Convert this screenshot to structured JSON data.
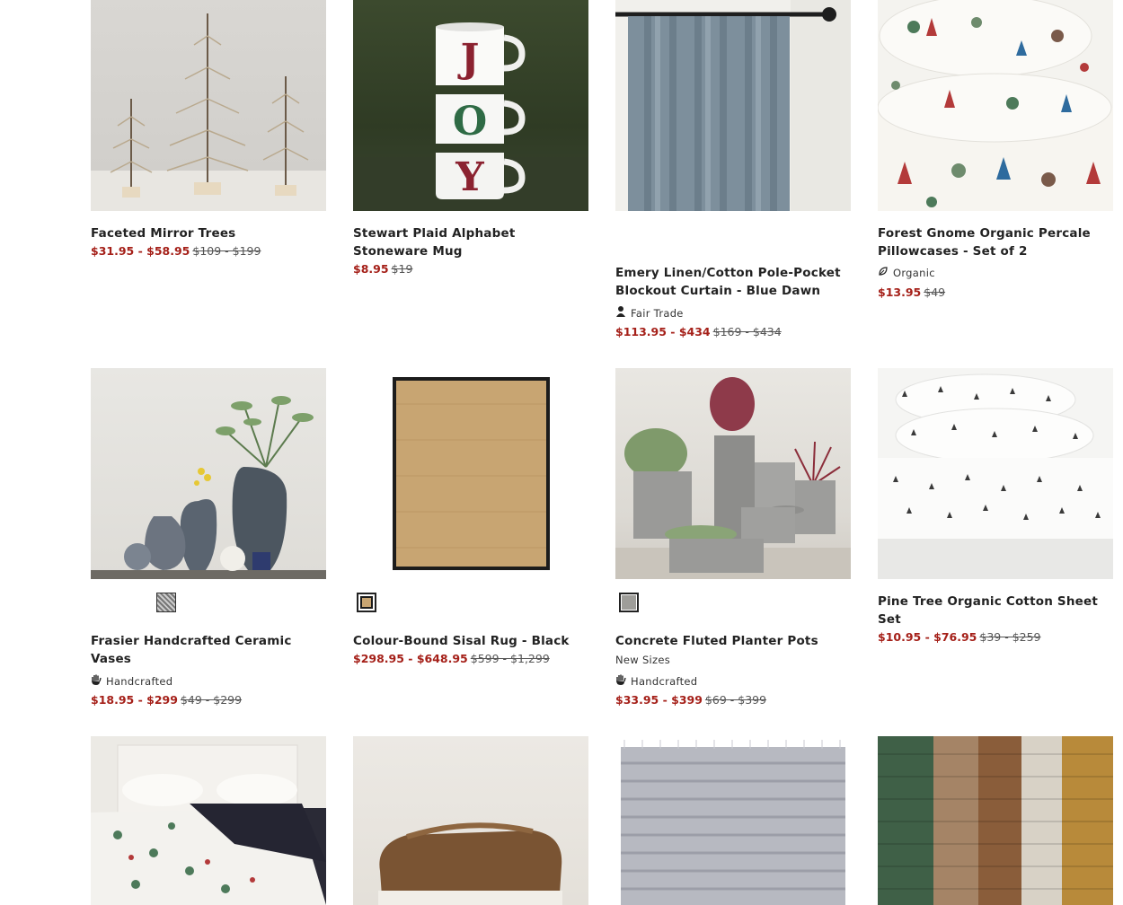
{
  "products": [
    {
      "title": "Faceted Mirror Trees",
      "sale": "$31.95 - $58.95",
      "orig": "$109 - $199"
    },
    {
      "title": "Stewart Plaid Alphabet Stoneware Mug",
      "sale": "$8.95",
      "orig": "$19",
      "mug_letters": [
        "J",
        "O",
        "Y"
      ]
    },
    {
      "title": "Emery Linen/Cotton Pole-Pocket Blockout Curtain - Blue Dawn",
      "attr": "Fair Trade",
      "sale": "$113.95 - $434",
      "orig": "$169 - $434"
    },
    {
      "title": "Forest Gnome Organic Percale Pillowcases - Set of 2",
      "attr": "Organic",
      "sale": "$13.95",
      "orig": "$49"
    },
    {
      "title": "Frasier Handcrafted Ceramic Vases",
      "attr": "Handcrafted",
      "sale": "$18.95 - $299",
      "orig": "$49 - $299"
    },
    {
      "title": "Colour-Bound Sisal Rug - Black",
      "sale": "$298.95 - $648.95",
      "orig": "$599 - $1,299"
    },
    {
      "title": "Concrete Fluted Planter Pots",
      "badge": "New Sizes",
      "attr": "Handcrafted",
      "sale": "$33.95 - $399",
      "orig": "$69 - $399"
    },
    {
      "title": "Pine Tree Organic Cotton Sheet Set",
      "sale": "$10.95 - $76.95",
      "orig": "$39 - $259"
    }
  ]
}
